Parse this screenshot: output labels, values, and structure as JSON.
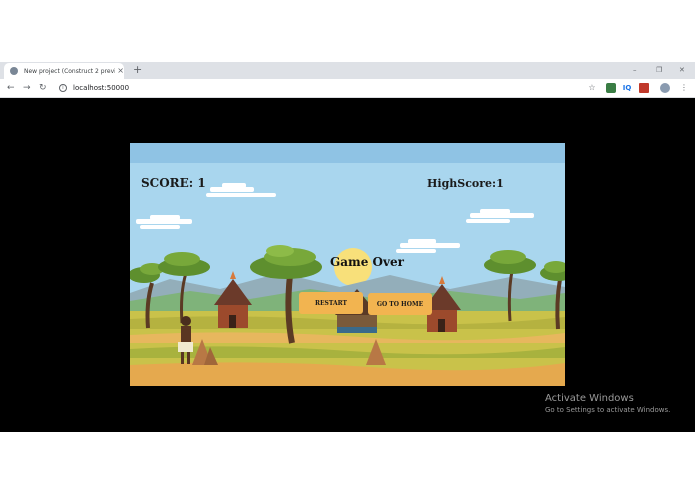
{
  "browser": {
    "tab_title": "New project (Construct 2 previe",
    "tab_close": "×",
    "new_tab": "+",
    "url": "localhost:50000",
    "window_controls": [
      "–",
      "❐",
      "✕"
    ]
  },
  "game": {
    "score_label": "SCORE: 1",
    "highscore_label": "HighScore:1",
    "game_over": "Game Over",
    "restart_label": "RESTART",
    "home_label": "GO TO HOME"
  },
  "os": {
    "activate_title": "Activate Windows",
    "activate_sub": "Go to Settings to activate Windows."
  },
  "colors": {
    "sky": "#a9d6ee",
    "ground": "#c9c24a",
    "button": "#f2b450",
    "viewport": "#000000"
  }
}
